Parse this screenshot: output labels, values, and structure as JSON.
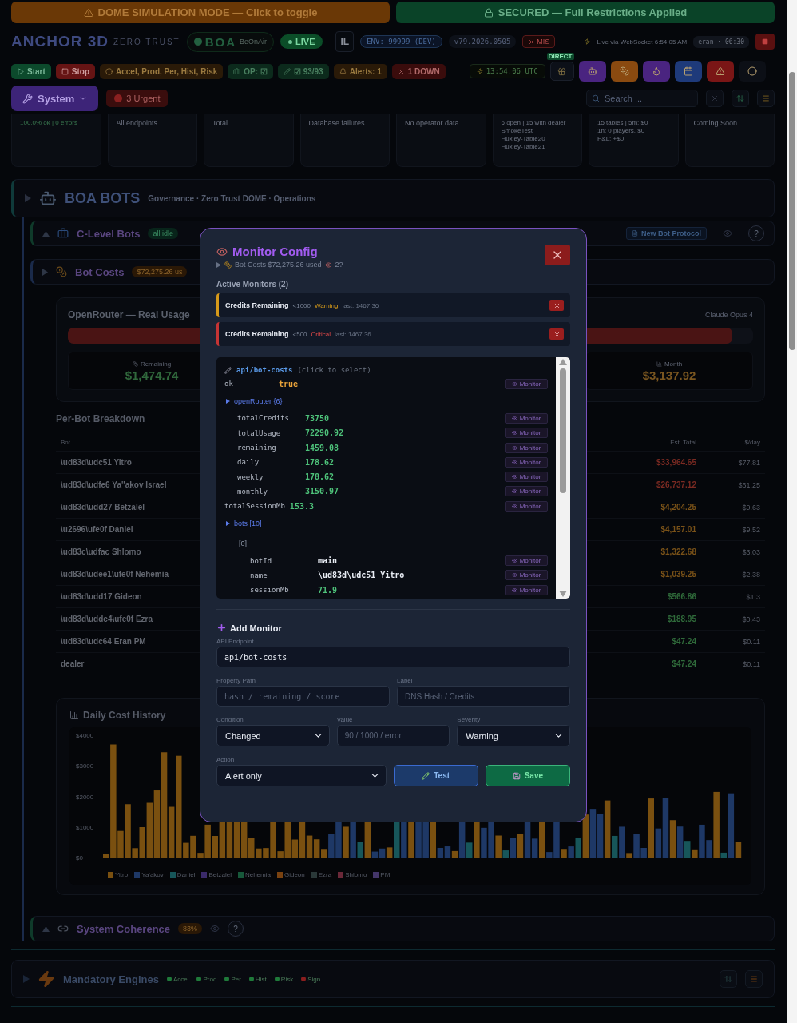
{
  "banners": [
    {
      "text": "DOME SIMULATION MODE — Click to toggle",
      "kind": "simulation"
    },
    {
      "text": "SECURED — Full Restrictions Applied",
      "kind": "secured"
    }
  ],
  "header": {
    "brand": "ANCHOR 3D",
    "brand_sub": "ZERO TRUST",
    "boa": "BOA",
    "boa_sub": "BeOnAir",
    "live": "LIVE",
    "lang": "IL",
    "env": "ENV: 99999 (DEV)",
    "version": "v79.2026.0505",
    "mis": "MIS",
    "ws_status": "Live via WebSocket 6:54:05 AM",
    "user": "eran · 06:30"
  },
  "toolbar": {
    "chips": [
      {
        "text": "Start",
        "kind": "start"
      },
      {
        "text": "Stop",
        "kind": "stop"
      },
      {
        "text": "Accel, Prod, Per, Hist, Risk",
        "kind": "engines"
      },
      {
        "text": "OP: ☑",
        "kind": "op"
      },
      {
        "text": "☑ 93/93",
        "kind": "count"
      },
      {
        "text": "Alerts: 1",
        "kind": "alerts"
      },
      {
        "text": "1 DOWN",
        "kind": "down"
      }
    ],
    "clock": "13:54:06 UTC",
    "direct": "DIRECT",
    "icon_buttons": [
      {
        "color": "#4a2480"
      },
      {
        "color": "#8a4a10"
      },
      {
        "color": "#4a2480"
      },
      {
        "color": "#1e3a7a"
      },
      {
        "color": "#7a1616"
      },
      {
        "color": "#0c0f16"
      }
    ]
  },
  "nav": {
    "system": "System",
    "urgent": "3 Urgent",
    "search": {
      "placeholder": "Search ..."
    }
  },
  "stats": [
    {
      "lines": [
        "100.0% ok | 0 errors"
      ]
    },
    {
      "lines": [
        "All endpoints"
      ]
    },
    {
      "lines": [
        "Total"
      ]
    },
    {
      "lines": [
        "Database failures"
      ]
    },
    {
      "lines": [
        "No operator data"
      ]
    },
    {
      "lines": [
        "6 open | 15 with dealer",
        "SmokeTest",
        "Huxley-Table20",
        "Huxley-Table21"
      ]
    },
    {
      "lines": [
        "15 tables | 5m: $0",
        "1h: 0 players, $0",
        "P&L: +$0"
      ]
    },
    {
      "lines": [
        "Coming Soon"
      ]
    }
  ],
  "boa_bots": {
    "title": "BOA BOTS",
    "subtitle": "Governance · Zero Trust DOME · Operations",
    "c_level": {
      "title": "C-Level Bots",
      "badge": "all idle",
      "protocol_button": "New Bot Protocol",
      "help": "?"
    },
    "bot_costs": {
      "title": "Bot Costs",
      "badge": "$72,275.26 us",
      "usage": {
        "title": "OpenRouter — Real Usage",
        "model": "Claude Opus 4",
        "level": 0.97,
        "tiles": [
          {
            "label": "Remaining",
            "value": "$1,474.74",
            "kind": "remaining"
          },
          {
            "label": "Month",
            "value": "$3,137.92",
            "kind": "month"
          }
        ]
      },
      "breakdown": {
        "title": "Per-Bot Breakdown",
        "columns": [
          "Bot",
          "Est. Total",
          "$/day"
        ],
        "rows": [
          {
            "bot": "\\ud83d\\udc51 Yitro",
            "total": "$33,964.65",
            "per_day": "$77.81",
            "color": "#7a2a22"
          },
          {
            "bot": "\\ud83d\\udfe6 Ya''akov Israel",
            "total": "$26,737.12",
            "per_day": "$61.25",
            "color": "#7a2a22"
          },
          {
            "bot": "\\ud83d\\udd27 Betzalel",
            "total": "$4,204.25",
            "per_day": "$9.63",
            "color": "#7a5218"
          },
          {
            "bot": "\\u2696\\ufe0f Daniel",
            "total": "$4,157.01",
            "per_day": "$9.52",
            "color": "#7a5218"
          },
          {
            "bot": "\\ud83c\\udfac Shlomo",
            "total": "$1,322.68",
            "per_day": "$3.03",
            "color": "#7a5218"
          },
          {
            "bot": "\\ud83d\\udee1\\ufe0f Nehemia",
            "total": "$1,039.25",
            "per_day": "$2.38",
            "color": "#7a5218"
          },
          {
            "bot": "\\ud83d\\udd17 Gideon",
            "total": "$566.86",
            "per_day": "$1.3",
            "color": "#2f6a3a"
          },
          {
            "bot": "\\ud83d\\uddc4\\ufe0f Ezra",
            "total": "$188.95",
            "per_day": "$0.43",
            "color": "#2f6a3a"
          },
          {
            "bot": "\\ud83d\\udc64 Eran PM",
            "total": "$47.24",
            "per_day": "$0.11",
            "color": "#2f6a3a"
          },
          {
            "bot": "dealer",
            "total": "$47.24",
            "per_day": "$0.11",
            "color": "#2f6a3a"
          }
        ]
      },
      "history": {
        "title": "Daily Cost History",
        "y_labels": [
          "$4000",
          "$3000",
          "$2000",
          "$1000",
          "$0"
        ],
        "legend": [
          {
            "name": "Yitro",
            "color": "#7a5010"
          },
          {
            "name": "Ya'akov",
            "color": "#1e3866"
          },
          {
            "name": "Daniel",
            "color": "#17565a"
          },
          {
            "name": "Betzalel",
            "color": "#3a2a6a"
          },
          {
            "name": "Nehemia",
            "color": "#17583a"
          },
          {
            "name": "Gideon",
            "color": "#7a4210"
          },
          {
            "name": "Ezra",
            "color": "#2a3838"
          },
          {
            "name": "Shlomo",
            "color": "#6a2838"
          },
          {
            "name": "PM",
            "color": "#44366a"
          }
        ]
      }
    },
    "coherence": {
      "title": "System Coherence",
      "badge": "83%",
      "help": "?"
    }
  },
  "engines": {
    "title": "Mandatory Engines",
    "items": [
      {
        "name": "Accel",
        "color": "#1f7a3a"
      },
      {
        "name": "Prod",
        "color": "#1f7a3a"
      },
      {
        "name": "Per",
        "color": "#1f7a3a"
      },
      {
        "name": "Hist",
        "color": "#1f7a3a"
      },
      {
        "name": "Risk",
        "color": "#1f7a3a"
      },
      {
        "name": "Sign",
        "color": "#8a1e1e"
      }
    ]
  },
  "modal": {
    "title": "Monitor Config",
    "subtitle": "Bot Costs $72,275.26 used",
    "count": "2?",
    "active_title": "Active Monitors (2)",
    "monitors": [
      {
        "label": "Credits Remaining",
        "condition": "<1000",
        "severity": "Warning",
        "kind": "warning",
        "last": "last: 1467.36"
      },
      {
        "label": "Credits Remaining",
        "condition": "<500",
        "severity": "Critical",
        "kind": "critical",
        "last": "last: 1467.36"
      }
    ],
    "tree": {
      "endpoint": "api/bot-costs",
      "hint": "(click to select)",
      "items": [
        {
          "kind": "field",
          "key": "ok",
          "value": "true",
          "color": "#e8a23a",
          "monitor": "Monitor"
        },
        {
          "kind": "group",
          "label": "openRouter {6}",
          "children": [
            {
              "kind": "field",
              "key": "totalCredits",
              "value": "73750",
              "color": "#4ec27a",
              "monitor": "Monitor"
            },
            {
              "kind": "field",
              "key": "totalUsage",
              "value": "72290.92",
              "color": "#4ec27a",
              "monitor": "Monitor"
            },
            {
              "kind": "field",
              "key": "remaining",
              "value": "1459.08",
              "color": "#4ec27a",
              "monitor": "Monitor"
            },
            {
              "kind": "field",
              "key": "daily",
              "value": "178.62",
              "color": "#4ec27a",
              "monitor": "Monitor"
            },
            {
              "kind": "field",
              "key": "weekly",
              "value": "178.62",
              "color": "#4ec27a",
              "monitor": "Monitor"
            },
            {
              "kind": "field",
              "key": "monthly",
              "value": "3150.97",
              "color": "#4ec27a",
              "monitor": "Monitor"
            }
          ]
        },
        {
          "kind": "field",
          "key": "totalSessionMb",
          "value": "153.3",
          "color": "#4ec27a",
          "monitor": "Monitor"
        },
        {
          "kind": "group",
          "label": "bots [10]",
          "children": [
            {
              "kind": "index",
              "label": "[0]",
              "children": [
                {
                  "kind": "field",
                  "key": "botId",
                  "value": "main",
                  "color": "#e8ecf4",
                  "monitor": "Monitor"
                },
                {
                  "kind": "field",
                  "key": "name",
                  "value": "\\ud83d\\udc51 Yitro",
                  "color": "#e8ecf4",
                  "monitor": "Monitor"
                },
                {
                  "kind": "field",
                  "key": "sessionMb",
                  "value": "71.9",
                  "color": "#4ec27a",
                  "monitor": "Monitor"
                }
              ]
            }
          ]
        }
      ]
    },
    "add_title": "Add Monitor",
    "form": {
      "endpoint": {
        "label": "API Endpoint",
        "value": "api/bot-costs"
      },
      "path": {
        "label": "Property Path",
        "placeholder": "hash / remaining / score"
      },
      "name": {
        "label": "Label",
        "placeholder": "DNS Hash / Credits"
      },
      "condition": {
        "label": "Condition",
        "value": "Changed"
      },
      "value": {
        "label": "Value",
        "placeholder": "90 / 1000 / error"
      },
      "severity": {
        "label": "Severity",
        "value": "Warning"
      },
      "action": {
        "label": "Action",
        "value": "Alert only"
      }
    },
    "buttons": {
      "test": "Test",
      "save": "Save"
    }
  }
}
